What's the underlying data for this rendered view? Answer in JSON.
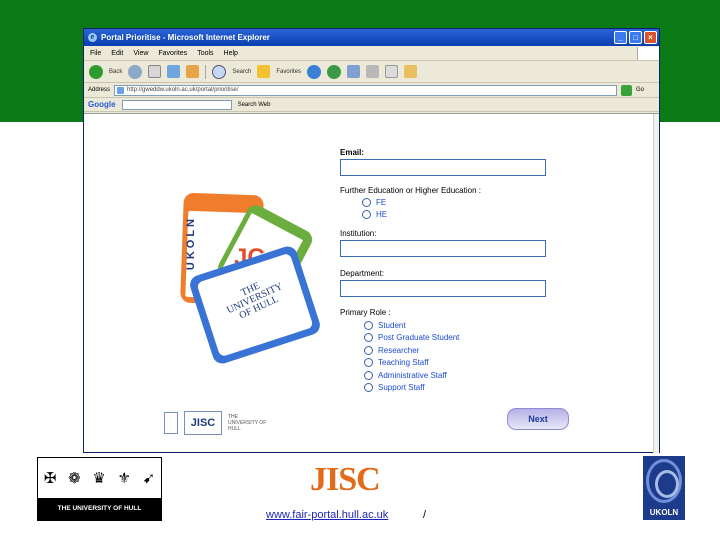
{
  "browser": {
    "title": "Portal Prioritise - Microsoft Internet Explorer",
    "menu": [
      "File",
      "Edit",
      "View",
      "Favorites",
      "Tools",
      "Help"
    ],
    "toolbar": {
      "back_label": "Back",
      "search_label": "Search",
      "favorites_label": "Favorites"
    },
    "address": {
      "label": "Address",
      "value": "http://gweddw.ukoln.ac.uk/portal/prioritise/",
      "go_label": "Go"
    },
    "google": {
      "logo": "Google",
      "search_web_label": "Search Web"
    }
  },
  "form": {
    "email_label": "Email:",
    "education_label": "Further Education or Higher Education :",
    "education_options": [
      "FE",
      "HE"
    ],
    "institution_label": "Institution:",
    "department_label": "Department:",
    "role_label": "Primary Role :",
    "role_options": [
      "Student",
      "Post Graduate Student",
      "Researcher",
      "Teaching Staff",
      "Administrative Staff",
      "Support Staff"
    ],
    "next_label": "Next"
  },
  "cards": {
    "ukoln_text": "UKOLN",
    "hull_text": "THE UNIVERSITY OF HULL",
    "jisc_text": "JISC"
  },
  "small_logos": {
    "jisc": "JISC",
    "hull": "THE UNIVERSITY OF HULL"
  },
  "footer": {
    "hull_name": "THE UNIVERSITY OF HULL",
    "jisc": "JISC",
    "link_text": "www.fair-portal.hull.ac.uk",
    "link_suffix": "/",
    "ukoln": "UKOLN"
  },
  "colors": {
    "band_green": "#0b7a16",
    "jisc_orange": "#e36a1a",
    "ukoln_blue": "#1e3a8a",
    "link_blue": "#1d26b8"
  }
}
